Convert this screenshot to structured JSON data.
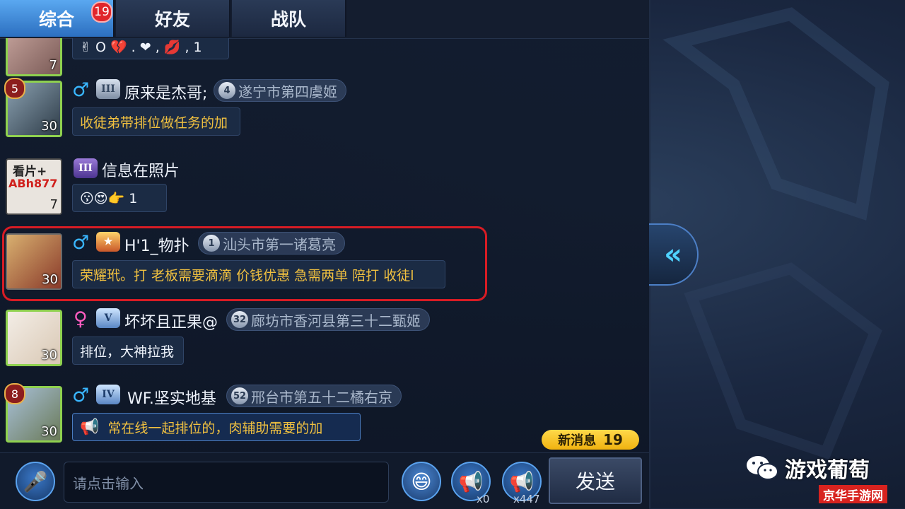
{
  "tabs": [
    {
      "label": "综合",
      "badge": "19",
      "active": true
    },
    {
      "label": "好友"
    },
    {
      "label": "战队"
    }
  ],
  "messages": [
    {
      "avatar_level": "7",
      "bubble": "✌ O 💔 . ❤ , 💋 ,  1"
    },
    {
      "vip": "5",
      "gender": "♂",
      "rank": "III",
      "name": "原来是杰哥;",
      "title_num": "4",
      "title": "遂宁市第四虞姬",
      "avatar_level": "30",
      "bubble": "收徒弟带排位做任务的加"
    },
    {
      "avatar_text_1": "看片+",
      "avatar_text_2": "ABh877",
      "rank": "III",
      "name": "信息在照片",
      "avatar_level": "7",
      "bubble": "😗😍👉 1"
    },
    {
      "gender": "♂",
      "rank": "★",
      "name": "H'1_物扑",
      "title_num": "1",
      "title": "汕头市第一诸葛亮",
      "avatar_level": "30",
      "bubble": "荣耀玳。打 老板需要滴滴 价钱优惠 急需两单 陪打 收徒l"
    },
    {
      "gender": "♀",
      "rank": "V",
      "name": "坏坏且正果@",
      "title_num": "32",
      "title": "廊坊市香河县第三十二甄姬",
      "avatar_level": "30",
      "bubble": "排位，大神拉我"
    },
    {
      "vip": "8",
      "gender": "♂",
      "rank": "IV",
      "name": "WF.坚实地基",
      "title_num": "52",
      "title": "邢台市第五十二橘右京",
      "avatar_level": "30",
      "bubble": "常在线一起排位的，肉辅助需要的加"
    }
  ],
  "new_messages": {
    "label": "新消息",
    "count": "19"
  },
  "input": {
    "placeholder": "请点击输入",
    "horn_small_count": "x0",
    "horn_large_count": "x447",
    "send_label": "发送"
  },
  "watermark": {
    "title": "游戏葡萄",
    "subtitle": "京华手游网"
  },
  "colors": {
    "accent_blue": "#39b6ff",
    "bubble_text": "#f0c040",
    "highlight_red": "#d81c24",
    "new_msg_yellow": "#ffd94a"
  }
}
